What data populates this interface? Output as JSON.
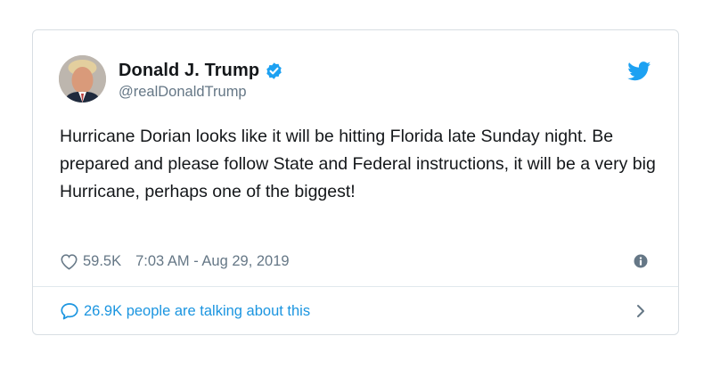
{
  "tweet": {
    "author": {
      "display_name": "Donald J. Trump",
      "handle": "@realDonaldTrump",
      "verified": true,
      "avatar_icon": "profile-photo"
    },
    "brand_icon": "twitter-bird-icon",
    "text": "Hurricane Dorian looks like it will be hitting Florida late Sunday night. Be prepared and please follow State and Federal instructions, it will be a very big Hurricane, perhaps one of the biggest!",
    "likes": "59.5K",
    "timestamp": "7:03 AM - Aug 29, 2019",
    "conversation_link": "26.9K people are talking about this"
  },
  "colors": {
    "text": "#14171a",
    "secondary": "#657786",
    "accent": "#1da1f2",
    "link": "#1b95e0",
    "border": "#d8dee3"
  }
}
